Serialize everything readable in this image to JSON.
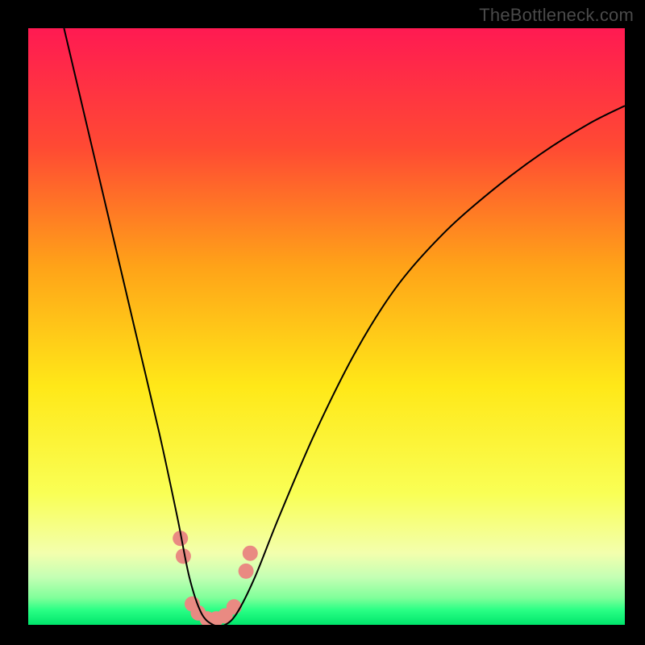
{
  "watermark": "TheBottleneck.com",
  "chart_data": {
    "type": "line",
    "title": "",
    "xlabel": "",
    "ylabel": "",
    "xlim": [
      0,
      100
    ],
    "ylim": [
      0,
      100
    ],
    "grid": false,
    "legend": false,
    "background_gradient": {
      "direction": "vertical",
      "stops": [
        {
          "pos": 0.0,
          "color": "#ff1a52"
        },
        {
          "pos": 0.2,
          "color": "#ff4a33"
        },
        {
          "pos": 0.4,
          "color": "#ffa318"
        },
        {
          "pos": 0.6,
          "color": "#ffe818"
        },
        {
          "pos": 0.78,
          "color": "#f9ff55"
        },
        {
          "pos": 0.88,
          "color": "#f3ffad"
        },
        {
          "pos": 0.92,
          "color": "#c4ffb4"
        },
        {
          "pos": 0.955,
          "color": "#7fff9a"
        },
        {
          "pos": 0.975,
          "color": "#2aff85"
        },
        {
          "pos": 1.0,
          "color": "#00e56b"
        }
      ]
    },
    "series": [
      {
        "name": "bottleneck-curve",
        "color": "#000000",
        "x": [
          6,
          10,
          14,
          18,
          22,
          25,
          27,
          29,
          31,
          33,
          35,
          38,
          42,
          48,
          55,
          62,
          70,
          78,
          86,
          94,
          100
        ],
        "values": [
          100,
          83,
          66,
          49,
          32,
          18,
          8,
          2,
          0,
          0,
          2,
          8,
          18,
          32,
          46,
          57,
          66,
          73,
          79,
          84,
          87
        ]
      }
    ],
    "markers": {
      "name": "dip-markers",
      "color": "#e98a82",
      "points": [
        {
          "x": 25.5,
          "y": 14.5
        },
        {
          "x": 26.0,
          "y": 11.5
        },
        {
          "x": 27.5,
          "y": 3.5
        },
        {
          "x": 28.5,
          "y": 2.0
        },
        {
          "x": 30.0,
          "y": 1.0
        },
        {
          "x": 31.5,
          "y": 1.0
        },
        {
          "x": 33.0,
          "y": 1.5
        },
        {
          "x": 34.5,
          "y": 3.0
        },
        {
          "x": 36.5,
          "y": 9.0
        },
        {
          "x": 37.2,
          "y": 12.0
        }
      ]
    }
  }
}
